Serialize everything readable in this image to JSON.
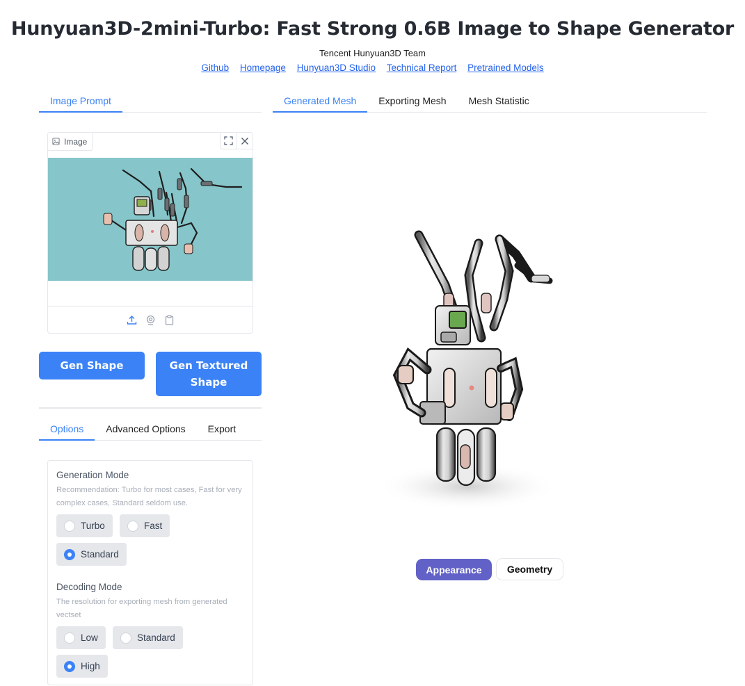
{
  "header": {
    "title": "Hunyuan3D-2mini-Turbo: Fast Strong 0.6B Image to Shape Generator",
    "team": "Tencent Hunyuan3D Team",
    "links": [
      "Github",
      "Homepage",
      "Hunyuan3D Studio",
      "Technical Report",
      "Pretrained Models"
    ]
  },
  "left_tabs": [
    "Image Prompt"
  ],
  "image_input": {
    "label": "Image",
    "icons": [
      "image-icon",
      "fullscreen-icon",
      "close-icon",
      "upload-icon",
      "webcam-icon",
      "clipboard-icon"
    ]
  },
  "buttons": {
    "gen_shape": "Gen Shape",
    "gen_textured_line1": "Gen Textured",
    "gen_textured_line2": "Shape"
  },
  "options_tabs": [
    "Options",
    "Advanced Options",
    "Export"
  ],
  "generation_mode": {
    "title": "Generation Mode",
    "description": "Recommendation: Turbo for most cases, Fast for very complex cases, Standard seldom use.",
    "options": [
      "Turbo",
      "Fast",
      "Standard"
    ],
    "selected": "Standard"
  },
  "decoding_mode": {
    "title": "Decoding Mode",
    "description": "The resolution for exporting mesh from generated vectset",
    "options": [
      "Low",
      "Standard",
      "High"
    ],
    "selected": "High"
  },
  "right_tabs": [
    "Generated Mesh",
    "Exporting Mesh",
    "Mesh Statistic"
  ],
  "view_toggle": {
    "appearance": "Appearance",
    "geometry": "Geometry",
    "active": "Appearance"
  },
  "colors": {
    "accent": "#3b82f6",
    "toggle_active": "#6161c7",
    "image_bg": "#86c5c9"
  }
}
